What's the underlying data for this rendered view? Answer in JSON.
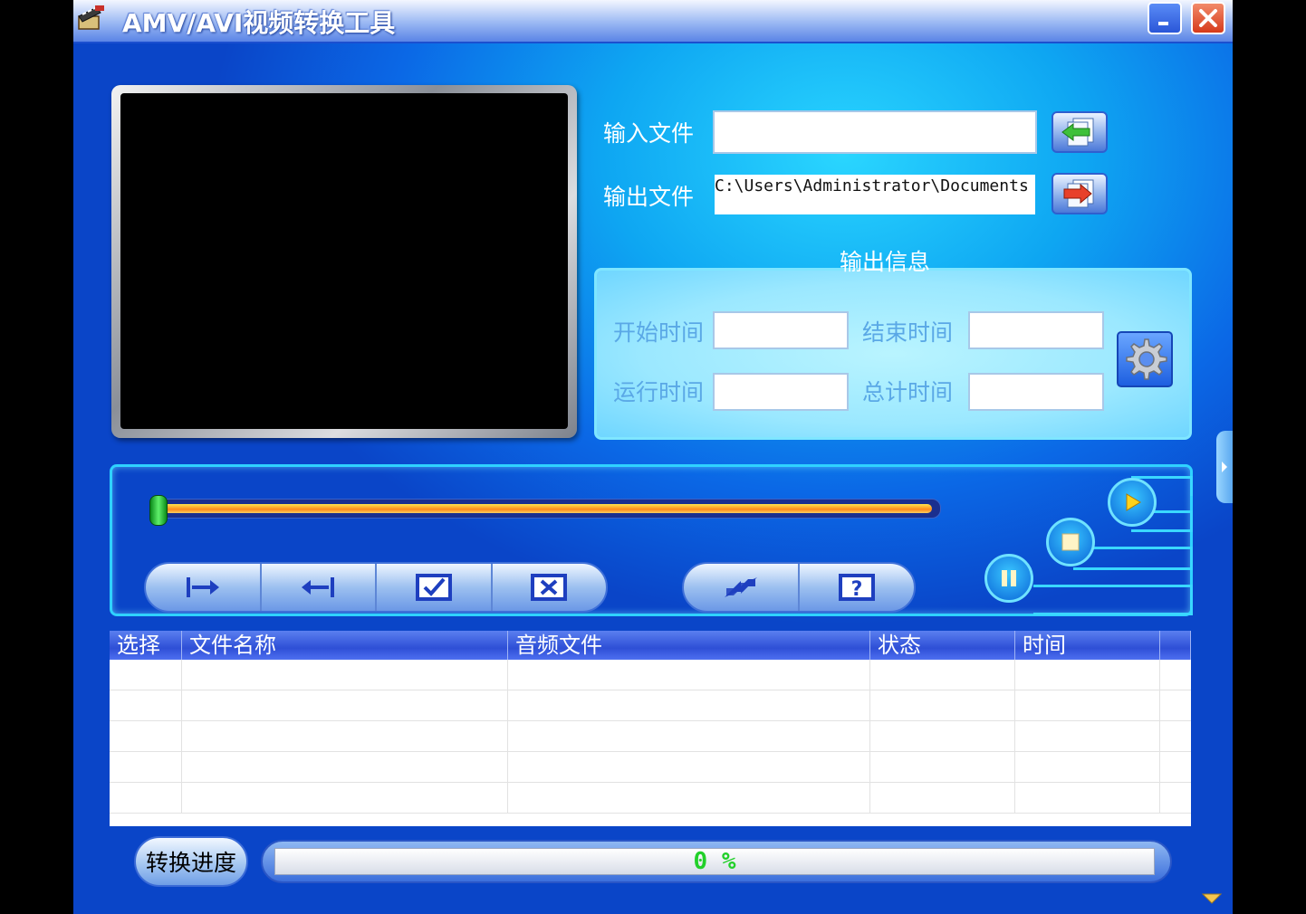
{
  "window": {
    "title": "AMV/AVI视频转换工具",
    "minimize_glyph": "_",
    "close_glyph": "✕"
  },
  "files": {
    "input_label": "输入文件",
    "input_value": "",
    "output_label": "输出文件",
    "output_value": "C:\\Users\\Administrator\\Documents"
  },
  "output_info": {
    "title": "输出信息",
    "start_time_label": "开始时间",
    "start_time_value": "",
    "end_time_label": "结束时间",
    "end_time_value": "",
    "run_time_label": "运行时间",
    "run_time_value": "",
    "total_time_label": "总计时间",
    "total_time_value": ""
  },
  "player": {
    "seek_position": 0.0
  },
  "table": {
    "columns": [
      "选择",
      "文件名称",
      "音频文件",
      "状态",
      "时间"
    ],
    "rows": [
      [
        "",
        "",
        "",
        "",
        ""
      ],
      [
        "",
        "",
        "",
        "",
        ""
      ],
      [
        "",
        "",
        "",
        "",
        ""
      ],
      [
        "",
        "",
        "",
        "",
        ""
      ],
      [
        "",
        "",
        "",
        "",
        ""
      ]
    ]
  },
  "progress": {
    "label": "转换进度",
    "percent_text": "0 %",
    "percent": 0
  },
  "colors": {
    "accent": "#0ea6f2",
    "header": "#2e4fd6",
    "progress_text": "#22d02a",
    "seek_fill": "#ff8a1a"
  },
  "icons": {
    "import": "import-file-icon",
    "export": "export-file-icon",
    "settings": "gear-icon",
    "mark_in": "mark-in-icon",
    "mark_out": "mark-out-icon",
    "check": "checkbox-check-icon",
    "remove": "checkbox-x-icon",
    "convert": "convert-arrows-icon",
    "help": "help-icon",
    "play": "play-icon",
    "stop": "stop-icon",
    "pause": "pause-icon"
  }
}
